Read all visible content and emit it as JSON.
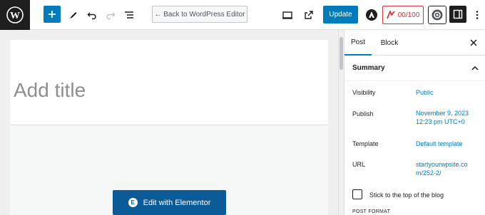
{
  "toolbar": {
    "back_label": "← Back to WordPress Editor",
    "update_label": "Update",
    "score_label": "00/100",
    "accent": "#007cba"
  },
  "editor": {
    "title_placeholder": "Add title",
    "elementor_button": "Edit with Elementor",
    "elementor_badge": "E"
  },
  "sidebar": {
    "tabs": [
      "Post",
      "Block"
    ],
    "summary_title": "Summary",
    "rows": [
      {
        "label": "Visibility",
        "value": "Public"
      },
      {
        "label": "Publish",
        "value_line1": "November 9, 2023",
        "value_line2": "12:23 pm UTC+0"
      },
      {
        "label": "Template",
        "value": "Default template"
      },
      {
        "label": "URL",
        "value_line1": "startyourwpsite.co",
        "value_line2": "m/252-2/"
      }
    ],
    "sticky_label": "Stick to the top of the blog",
    "post_format": "POST FORMAT"
  }
}
